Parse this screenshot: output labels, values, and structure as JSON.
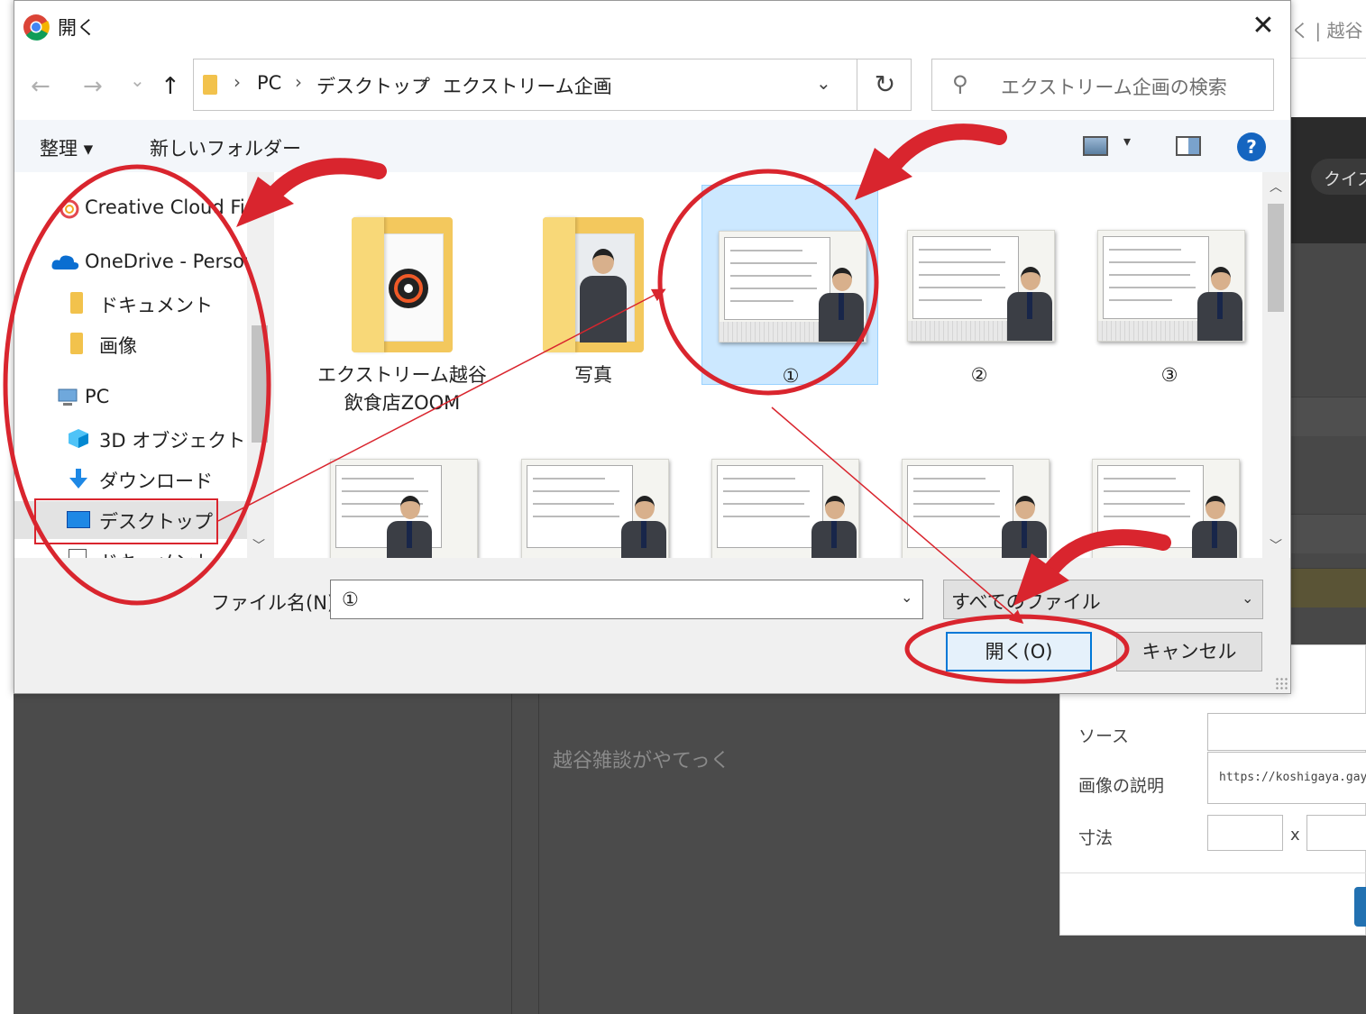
{
  "dialog": {
    "title": "開く",
    "close_glyph": "✕"
  },
  "nav": {
    "back_glyph": "←",
    "forward_glyph": "→",
    "recent_glyph": "⌄",
    "up_glyph": "↑",
    "breadcrumbs": [
      "PC",
      "デスクトップ",
      "エクストリーム企画"
    ],
    "crumb_sep": "›",
    "dropdown_glyph": "⌄",
    "refresh_glyph": "↻",
    "search_icon": "⚲",
    "search_placeholder": "エクストリーム企画の検索"
  },
  "toolbar": {
    "organize_label": "整理 ▾",
    "new_folder_label": "新しいフォルダー",
    "view_caret": "▾",
    "help_label": "?"
  },
  "sidebar": {
    "items": [
      {
        "label": "Creative Cloud Fi",
        "icon": "creative-cloud-icon"
      },
      {
        "label": "OneDrive - Person",
        "icon": "onedrive-icon"
      },
      {
        "label": "ドキュメント",
        "icon": "folder-icon"
      },
      {
        "label": "画像",
        "icon": "folder-icon"
      },
      {
        "label": "PC",
        "icon": "pc-icon"
      },
      {
        "label": "3D オブジェクト",
        "icon": "3d-objects-icon"
      },
      {
        "label": "ダウンロード",
        "icon": "download-icon"
      },
      {
        "label": "デスクトップ",
        "icon": "desktop-icon",
        "selected": true
      },
      {
        "label": "ドキュメント",
        "icon": "document-icon"
      }
    ],
    "scroll_up": "︿",
    "scroll_down": "﹀"
  },
  "files": {
    "row1": [
      {
        "label_line1": "エクストリーム越谷",
        "label_line2": "飲食店ZOOM",
        "type": "folder"
      },
      {
        "label_line1": "写真",
        "label_line2": "",
        "type": "folder"
      },
      {
        "label_line1": "①",
        "label_line2": "",
        "type": "image",
        "selected": true
      },
      {
        "label_line1": "②",
        "label_line2": "",
        "type": "image"
      },
      {
        "label_line1": "③",
        "label_line2": "",
        "type": "image"
      }
    ],
    "row2_count_label": "",
    "scroll_up": "︿",
    "scroll_down": "﹀"
  },
  "bottom": {
    "filename_label": "ファイル名(N):",
    "filename_value": "①",
    "filename_caret": "⌄",
    "filetype_value": "すべてのファイル",
    "filetype_caret": "⌄",
    "open_label": "開く(O)",
    "cancel_label": "キャンセル"
  },
  "background": {
    "tab_text": "く | 越谷",
    "pill_text": "クイズ",
    "editor_text": "越谷雑談がやてっく",
    "media_panel": {
      "source_label": "ソース",
      "description_label": "画像の説明",
      "description_value": "https://koshigaya.gaya",
      "size_label": "寸法",
      "size_x": "x"
    }
  },
  "colors": {
    "annotation_red": "#d9252e",
    "accent_blue": "#0078d7",
    "selection_bg": "#cce8ff"
  }
}
